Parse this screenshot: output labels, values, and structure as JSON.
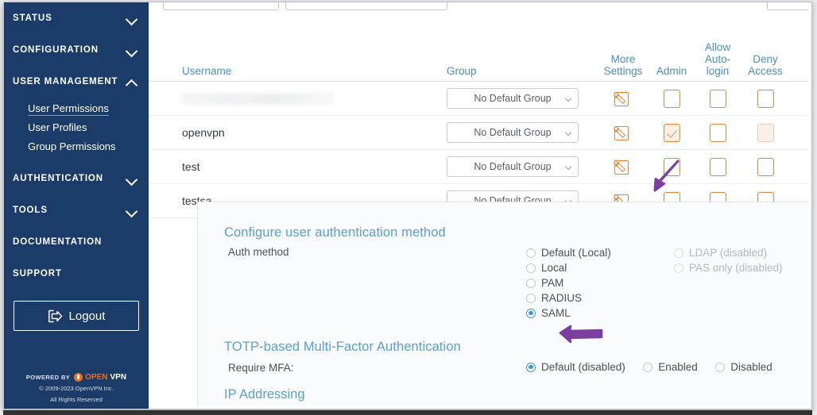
{
  "sidebar": {
    "groups": [
      {
        "label": "STATUS",
        "expanded": false
      },
      {
        "label": "CONFIGURATION",
        "expanded": false
      },
      {
        "label": "USER MANAGEMENT",
        "expanded": true
      }
    ],
    "user_management_items": [
      {
        "label": "User Permissions",
        "active": true
      },
      {
        "label": "User Profiles",
        "active": false
      },
      {
        "label": "Group Permissions",
        "active": false
      }
    ],
    "groups_lower": [
      {
        "label": "AUTHENTICATION",
        "expanded": false
      },
      {
        "label": "TOOLS",
        "expanded": false
      }
    ],
    "plain_items": [
      {
        "label": "DOCUMENTATION"
      },
      {
        "label": "SUPPORT"
      }
    ],
    "logout_label": "Logout",
    "footer": {
      "powered_by": "POWERED BY",
      "brand_open": "OPEN",
      "brand_vpn": "VPN",
      "copyright": "© 2009-2023 OpenVPN Inc.",
      "rights": "All Rights Reserved"
    }
  },
  "table": {
    "headers": {
      "username": "Username",
      "group": "Group",
      "more_settings": "More Settings",
      "more_settings_l1": "More",
      "more_settings_l2": "Settings",
      "admin": "Admin",
      "allow_autologin_l1": "Allow",
      "allow_autologin_l2": "Auto-",
      "allow_autologin_l3": "login",
      "deny_access_l1": "Deny",
      "deny_access_l2": "Access"
    },
    "group_select_value": "No Default Group",
    "rows": [
      {
        "username": "",
        "redacted": true,
        "group": "No Default Group",
        "admin": false,
        "autologin": false,
        "deny": false,
        "deny_dim": false
      },
      {
        "username": "openvpn",
        "redacted": false,
        "group": "No Default Group",
        "admin": true,
        "autologin": false,
        "deny": false,
        "deny_dim": true
      },
      {
        "username": "test",
        "redacted": false,
        "group": "No Default Group",
        "admin": false,
        "autologin": false,
        "deny": false,
        "deny_dim": false
      },
      {
        "username": "testsa",
        "redacted": false,
        "group": "No Default Group",
        "admin": false,
        "autologin": false,
        "deny": false,
        "deny_dim": false
      }
    ]
  },
  "panel": {
    "auth_section_title": "Configure user authentication method",
    "auth_field_label": "Auth method",
    "auth_options_col1": [
      {
        "label": "Default (Local)",
        "selected": false,
        "disabled": false
      },
      {
        "label": "Local",
        "selected": false,
        "disabled": false
      },
      {
        "label": "PAM",
        "selected": false,
        "disabled": false
      },
      {
        "label": "RADIUS",
        "selected": false,
        "disabled": false
      },
      {
        "label": "SAML",
        "selected": true,
        "disabled": false
      }
    ],
    "auth_options_col2": [
      {
        "label": "LDAP (disabled)",
        "selected": false,
        "disabled": true
      },
      {
        "label": "PAS only (disabled)",
        "selected": false,
        "disabled": true
      }
    ],
    "mfa_section_title": "TOTP-based Multi-Factor Authentication",
    "mfa_field_label": "Require MFA:",
    "mfa_options": [
      {
        "label": "Default (disabled)",
        "selected": true
      },
      {
        "label": "Enabled",
        "selected": false
      },
      {
        "label": "Disabled",
        "selected": false
      }
    ],
    "next_section_title": "IP Addressing"
  },
  "colors": {
    "sidebar_bg": "#1b3c68",
    "accent_orange": "#e2853f",
    "link_blue": "#4a90c4",
    "radio_blue": "#3d9bd4",
    "annotation_purple": "#7b3fa0"
  }
}
